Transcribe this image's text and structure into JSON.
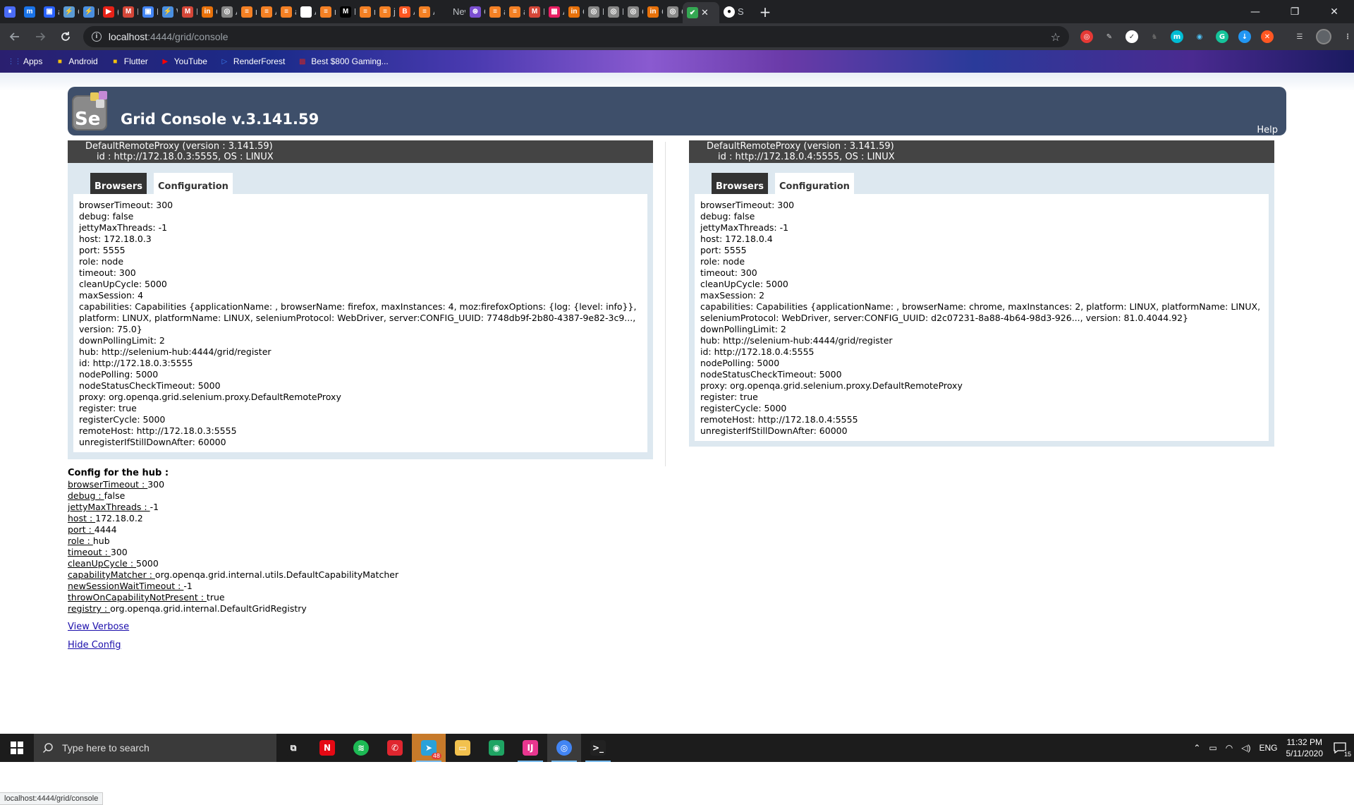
{
  "browser": {
    "tabs": [
      {
        "label": "",
        "color": "#4a6cf7",
        "glyph": "⏸"
      },
      {
        "label": "",
        "color": "#1a73e8",
        "glyph": "m"
      },
      {
        "label": "ar",
        "color": "#2962ff",
        "glyph": "▣"
      },
      {
        "label": "C",
        "color": "#5b9bd5",
        "glyph": "⚡"
      },
      {
        "label": "Lı",
        "color": "#4a8fe0",
        "glyph": "⚡"
      },
      {
        "label": "(2",
        "color": "#e62117",
        "glyph": "▶"
      },
      {
        "label": "Ir",
        "color": "#d44638",
        "glyph": "M"
      },
      {
        "label": "D",
        "color": "#4285f4",
        "glyph": "▣"
      },
      {
        "label": "W",
        "color": "#4a8fe0",
        "glyph": "⚡"
      },
      {
        "label": "Ir",
        "color": "#d44638",
        "glyph": "M"
      },
      {
        "label": "C",
        "color": "#e8710a",
        "glyph": "in"
      },
      {
        "label": "A",
        "color": "#888888",
        "glyph": "◎"
      },
      {
        "label": "m",
        "color": "#f48024",
        "glyph": "≡"
      },
      {
        "label": "A",
        "color": "#f48024",
        "glyph": "≡"
      },
      {
        "label": "ar",
        "color": "#f48024",
        "glyph": "≡"
      },
      {
        "label": "A",
        "color": "#ffffff",
        "glyph": "⊗"
      },
      {
        "label": "n",
        "color": "#f48024",
        "glyph": "≡"
      },
      {
        "label": "E",
        "color": "#000000",
        "glyph": "M"
      },
      {
        "label": "n",
        "color": "#f48024",
        "glyph": "≡"
      },
      {
        "label": "je",
        "color": "#f48024",
        "glyph": "≡"
      },
      {
        "label": "A",
        "color": "#ff5722",
        "glyph": "B"
      },
      {
        "label": "A",
        "color": "#f48024",
        "glyph": "≡"
      },
      {
        "label": "New",
        "color": "#202124",
        "glyph": ""
      },
      {
        "label": "C",
        "color": "#7b4fd0",
        "glyph": "⊛"
      },
      {
        "label": "a",
        "color": "#f48024",
        "glyph": "≡"
      },
      {
        "label": "a",
        "color": "#f48024",
        "glyph": "≡"
      },
      {
        "label": "Ir",
        "color": "#d44638",
        "glyph": "M"
      },
      {
        "label": "A",
        "color": "#e91e63",
        "glyph": "▦"
      },
      {
        "label": "C",
        "color": "#e8710a",
        "glyph": "in"
      },
      {
        "label": "H",
        "color": "#888888",
        "glyph": "◎"
      },
      {
        "label": "L",
        "color": "#888888",
        "glyph": "◎"
      },
      {
        "label": "C",
        "color": "#888888",
        "glyph": "◎"
      },
      {
        "label": "C",
        "color": "#e8710a",
        "glyph": "in"
      },
      {
        "label": "C",
        "color": "#888888",
        "glyph": "◎"
      }
    ],
    "active_tab": {
      "label": "",
      "glyph": "✔"
    },
    "github_tab": {
      "label": "S",
      "glyph": "●"
    },
    "url_host": "localhost",
    "url_path": ":4444/grid/console",
    "bookmarks": [
      {
        "label": "Apps",
        "icon": "apps-grid-icon",
        "color": "#4285f4",
        "glyph": "⋮⋮"
      },
      {
        "label": "Android",
        "icon": "folder-icon",
        "color": "#f4c20d",
        "glyph": "■"
      },
      {
        "label": "Flutter",
        "icon": "folder-icon",
        "color": "#f4c20d",
        "glyph": "■"
      },
      {
        "label": "YouTube",
        "icon": "youtube-icon",
        "color": "#ff0000",
        "glyph": "▶"
      },
      {
        "label": "RenderForest",
        "icon": "renderforest-icon",
        "color": "#3b82f6",
        "glyph": "▷"
      },
      {
        "label": "Best $800 Gaming...",
        "icon": "site-icon",
        "color": "#c62828",
        "glyph": "▩"
      }
    ]
  },
  "header": {
    "title": "Grid Console v.3.141.59",
    "help": "Help"
  },
  "proxies": [
    {
      "title": "DefaultRemoteProxy (version : 3.141.59)",
      "id_line": "id : http://172.18.0.3:5555, OS : LINUX",
      "tab_browsers": "Browsers",
      "tab_config": "Configuration",
      "config": [
        "browserTimeout: 300",
        "debug: false",
        "jettyMaxThreads: -1",
        "host: 172.18.0.3",
        "port: 5555",
        "role: node",
        "timeout: 300",
        "cleanUpCycle: 5000",
        "maxSession: 4",
        "capabilities: Capabilities {applicationName: , browserName: firefox, maxInstances: 4, moz:firefoxOptions: {log: {level: info}}, platform: LINUX, platformName: LINUX, seleniumProtocol: WebDriver, server:CONFIG_UUID: 7748db9f-2b80-4387-9e82-3c9..., version: 75.0}",
        "downPollingLimit: 2",
        "hub: http://selenium-hub:4444/grid/register",
        "id: http://172.18.0.3:5555",
        "nodePolling: 5000",
        "nodeStatusCheckTimeout: 5000",
        "proxy: org.openqa.grid.selenium.proxy.DefaultRemoteProxy",
        "register: true",
        "registerCycle: 5000",
        "remoteHost: http://172.18.0.3:5555",
        "unregisterIfStillDownAfter: 60000"
      ]
    },
    {
      "title": "DefaultRemoteProxy (version : 3.141.59)",
      "id_line": "id : http://172.18.0.4:5555, OS : LINUX",
      "tab_browsers": "Browsers",
      "tab_config": "Configuration",
      "config": [
        "browserTimeout: 300",
        "debug: false",
        "jettyMaxThreads: -1",
        "host: 172.18.0.4",
        "port: 5555",
        "role: node",
        "timeout: 300",
        "cleanUpCycle: 5000",
        "maxSession: 2",
        "capabilities: Capabilities {applicationName: , browserName: chrome, maxInstances: 2, platform: LINUX, platformName: LINUX, seleniumProtocol: WebDriver, server:CONFIG_UUID: d2c07231-8a88-4b64-98d3-926..., version: 81.0.4044.92}",
        "downPollingLimit: 2",
        "hub: http://selenium-hub:4444/grid/register",
        "id: http://172.18.0.4:5555",
        "nodePolling: 5000",
        "nodeStatusCheckTimeout: 5000",
        "proxy: org.openqa.grid.selenium.proxy.DefaultRemoteProxy",
        "register: true",
        "registerCycle: 5000",
        "remoteHost: http://172.18.0.4:5555",
        "unregisterIfStillDownAfter: 60000"
      ]
    }
  ],
  "hub": {
    "title": "Config for the hub :",
    "items": [
      {
        "key": "browserTimeout : ",
        "value": "300"
      },
      {
        "key": "debug : ",
        "value": "false"
      },
      {
        "key": "jettyMaxThreads : ",
        "value": "-1"
      },
      {
        "key": "host : ",
        "value": "172.18.0.2"
      },
      {
        "key": "port : ",
        "value": "4444"
      },
      {
        "key": "role : ",
        "value": "hub"
      },
      {
        "key": "timeout : ",
        "value": "300"
      },
      {
        "key": "cleanUpCycle : ",
        "value": "5000"
      },
      {
        "key": "capabilityMatcher : ",
        "value": "org.openqa.grid.internal.utils.DefaultCapabilityMatcher"
      },
      {
        "key": "newSessionWaitTimeout : ",
        "value": "-1"
      },
      {
        "key": "throwOnCapabilityNotPresent : ",
        "value": "true"
      },
      {
        "key": "registry : ",
        "value": "org.openqa.grid.internal.DefaultGridRegistry"
      }
    ],
    "view_verbose": "View Verbose",
    "hide_config": "Hide Config"
  },
  "status_url": "localhost:4444/grid/console",
  "taskbar": {
    "search_placeholder": "Type here to search",
    "apps": [
      {
        "name": "task-view",
        "color": "#1c1c1c",
        "glyph": "⧉"
      },
      {
        "name": "netflix",
        "color": "#e50914",
        "glyph": "N"
      },
      {
        "name": "spotify",
        "color": "#1db954",
        "glyph": "≋"
      },
      {
        "name": "whatsapp",
        "color": "#e0262f",
        "glyph": "✆"
      },
      {
        "name": "telegram",
        "color": "#2aa1da",
        "glyph": "➤"
      },
      {
        "name": "file-explorer",
        "color": "#f2c14e",
        "glyph": "▭"
      },
      {
        "name": "maps",
        "color": "#1fa463",
        "glyph": "◉"
      },
      {
        "name": "intellij",
        "color": "#e8368f",
        "glyph": "IJ"
      },
      {
        "name": "chrome",
        "color": "#4285f4",
        "glyph": "◎"
      },
      {
        "name": "terminal",
        "color": "#222222",
        "glyph": ">_"
      }
    ],
    "telegram_badge": "48",
    "lang": "ENG",
    "time": "11:32 PM",
    "date": "5/11/2020",
    "notifications": "15"
  }
}
